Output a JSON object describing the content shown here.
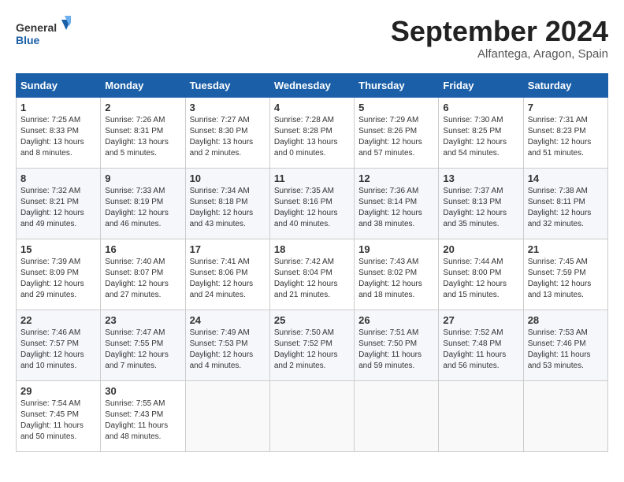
{
  "header": {
    "logo_general": "General",
    "logo_blue": "Blue",
    "month_title": "September 2024",
    "location": "Alfantega, Aragon, Spain"
  },
  "days_of_week": [
    "Sunday",
    "Monday",
    "Tuesday",
    "Wednesday",
    "Thursday",
    "Friday",
    "Saturday"
  ],
  "weeks": [
    [
      {
        "day": "1",
        "lines": [
          "Sunrise: 7:25 AM",
          "Sunset: 8:33 PM",
          "Daylight: 13 hours",
          "and 8 minutes."
        ]
      },
      {
        "day": "2",
        "lines": [
          "Sunrise: 7:26 AM",
          "Sunset: 8:31 PM",
          "Daylight: 13 hours",
          "and 5 minutes."
        ]
      },
      {
        "day": "3",
        "lines": [
          "Sunrise: 7:27 AM",
          "Sunset: 8:30 PM",
          "Daylight: 13 hours",
          "and 2 minutes."
        ]
      },
      {
        "day": "4",
        "lines": [
          "Sunrise: 7:28 AM",
          "Sunset: 8:28 PM",
          "Daylight: 13 hours",
          "and 0 minutes."
        ]
      },
      {
        "day": "5",
        "lines": [
          "Sunrise: 7:29 AM",
          "Sunset: 8:26 PM",
          "Daylight: 12 hours",
          "and 57 minutes."
        ]
      },
      {
        "day": "6",
        "lines": [
          "Sunrise: 7:30 AM",
          "Sunset: 8:25 PM",
          "Daylight: 12 hours",
          "and 54 minutes."
        ]
      },
      {
        "day": "7",
        "lines": [
          "Sunrise: 7:31 AM",
          "Sunset: 8:23 PM",
          "Daylight: 12 hours",
          "and 51 minutes."
        ]
      }
    ],
    [
      {
        "day": "8",
        "lines": [
          "Sunrise: 7:32 AM",
          "Sunset: 8:21 PM",
          "Daylight: 12 hours",
          "and 49 minutes."
        ]
      },
      {
        "day": "9",
        "lines": [
          "Sunrise: 7:33 AM",
          "Sunset: 8:19 PM",
          "Daylight: 12 hours",
          "and 46 minutes."
        ]
      },
      {
        "day": "10",
        "lines": [
          "Sunrise: 7:34 AM",
          "Sunset: 8:18 PM",
          "Daylight: 12 hours",
          "and 43 minutes."
        ]
      },
      {
        "day": "11",
        "lines": [
          "Sunrise: 7:35 AM",
          "Sunset: 8:16 PM",
          "Daylight: 12 hours",
          "and 40 minutes."
        ]
      },
      {
        "day": "12",
        "lines": [
          "Sunrise: 7:36 AM",
          "Sunset: 8:14 PM",
          "Daylight: 12 hours",
          "and 38 minutes."
        ]
      },
      {
        "day": "13",
        "lines": [
          "Sunrise: 7:37 AM",
          "Sunset: 8:13 PM",
          "Daylight: 12 hours",
          "and 35 minutes."
        ]
      },
      {
        "day": "14",
        "lines": [
          "Sunrise: 7:38 AM",
          "Sunset: 8:11 PM",
          "Daylight: 12 hours",
          "and 32 minutes."
        ]
      }
    ],
    [
      {
        "day": "15",
        "lines": [
          "Sunrise: 7:39 AM",
          "Sunset: 8:09 PM",
          "Daylight: 12 hours",
          "and 29 minutes."
        ]
      },
      {
        "day": "16",
        "lines": [
          "Sunrise: 7:40 AM",
          "Sunset: 8:07 PM",
          "Daylight: 12 hours",
          "and 27 minutes."
        ]
      },
      {
        "day": "17",
        "lines": [
          "Sunrise: 7:41 AM",
          "Sunset: 8:06 PM",
          "Daylight: 12 hours",
          "and 24 minutes."
        ]
      },
      {
        "day": "18",
        "lines": [
          "Sunrise: 7:42 AM",
          "Sunset: 8:04 PM",
          "Daylight: 12 hours",
          "and 21 minutes."
        ]
      },
      {
        "day": "19",
        "lines": [
          "Sunrise: 7:43 AM",
          "Sunset: 8:02 PM",
          "Daylight: 12 hours",
          "and 18 minutes."
        ]
      },
      {
        "day": "20",
        "lines": [
          "Sunrise: 7:44 AM",
          "Sunset: 8:00 PM",
          "Daylight: 12 hours",
          "and 15 minutes."
        ]
      },
      {
        "day": "21",
        "lines": [
          "Sunrise: 7:45 AM",
          "Sunset: 7:59 PM",
          "Daylight: 12 hours",
          "and 13 minutes."
        ]
      }
    ],
    [
      {
        "day": "22",
        "lines": [
          "Sunrise: 7:46 AM",
          "Sunset: 7:57 PM",
          "Daylight: 12 hours",
          "and 10 minutes."
        ]
      },
      {
        "day": "23",
        "lines": [
          "Sunrise: 7:47 AM",
          "Sunset: 7:55 PM",
          "Daylight: 12 hours",
          "and 7 minutes."
        ]
      },
      {
        "day": "24",
        "lines": [
          "Sunrise: 7:49 AM",
          "Sunset: 7:53 PM",
          "Daylight: 12 hours",
          "and 4 minutes."
        ]
      },
      {
        "day": "25",
        "lines": [
          "Sunrise: 7:50 AM",
          "Sunset: 7:52 PM",
          "Daylight: 12 hours",
          "and 2 minutes."
        ]
      },
      {
        "day": "26",
        "lines": [
          "Sunrise: 7:51 AM",
          "Sunset: 7:50 PM",
          "Daylight: 11 hours",
          "and 59 minutes."
        ]
      },
      {
        "day": "27",
        "lines": [
          "Sunrise: 7:52 AM",
          "Sunset: 7:48 PM",
          "Daylight: 11 hours",
          "and 56 minutes."
        ]
      },
      {
        "day": "28",
        "lines": [
          "Sunrise: 7:53 AM",
          "Sunset: 7:46 PM",
          "Daylight: 11 hours",
          "and 53 minutes."
        ]
      }
    ],
    [
      {
        "day": "29",
        "lines": [
          "Sunrise: 7:54 AM",
          "Sunset: 7:45 PM",
          "Daylight: 11 hours",
          "and 50 minutes."
        ]
      },
      {
        "day": "30",
        "lines": [
          "Sunrise: 7:55 AM",
          "Sunset: 7:43 PM",
          "Daylight: 11 hours",
          "and 48 minutes."
        ]
      },
      {
        "day": "",
        "lines": []
      },
      {
        "day": "",
        "lines": []
      },
      {
        "day": "",
        "lines": []
      },
      {
        "day": "",
        "lines": []
      },
      {
        "day": "",
        "lines": []
      }
    ]
  ]
}
